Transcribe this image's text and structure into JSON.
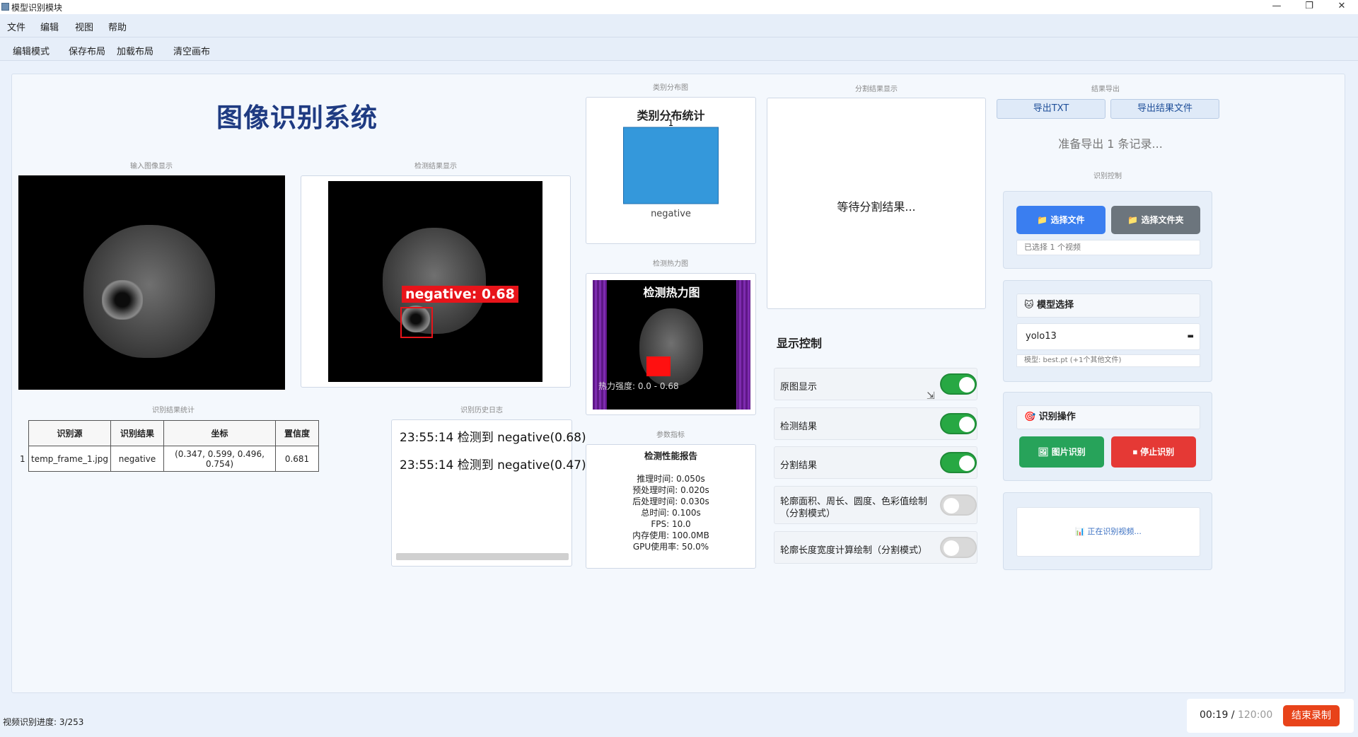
{
  "window": {
    "title": "模型识别模块",
    "controls": {
      "minimize": "—",
      "restore": "❐",
      "close": "✕"
    }
  },
  "menu": [
    "文件",
    "编辑",
    "视图",
    "帮助"
  ],
  "toolbar": [
    "编辑模式",
    "保存布局",
    "加载布局",
    "清空画布"
  ],
  "main_title": "图像识别系统",
  "captions": {
    "input_image": "输入图像显示",
    "result_image": "检测结果显示",
    "category_chart": "类别分布图",
    "segment": "分割结果显示",
    "export": "结果导出",
    "results_table": "识别结果统计",
    "history": "识别历史日志",
    "heatmap": "检测热力图",
    "params": "参数指标",
    "recognition_control": "识别控制"
  },
  "detection": {
    "label": "negative: 0.68"
  },
  "results_table": {
    "headers": [
      "识别源",
      "识别结果",
      "坐标",
      "置信度"
    ],
    "rows": [
      {
        "index": "1",
        "source": "temp_frame_1.jpg",
        "result": "negative",
        "coords": "(0.347, 0.599, 0.496, 0.754)",
        "confidence": "0.681"
      }
    ]
  },
  "history_log": [
    "23:55:14 检测到 negative(0.68)",
    "23:55:14 检测到 negative(0.47)"
  ],
  "chart_data": {
    "type": "bar",
    "title": "类别分布统计",
    "categories": [
      "negative"
    ],
    "values": [
      1
    ],
    "ylim": [
      0,
      1
    ],
    "color": "#3498db"
  },
  "heatmap": {
    "title": "检测热力图",
    "range_text": "热力强度: 0.0 - 0.68"
  },
  "perf_report": {
    "title": "检测性能报告",
    "lines": [
      "推理时间: 0.050s",
      "预处理时间: 0.020s",
      "后处理时间: 0.030s",
      "总时间: 0.100s",
      "FPS: 10.0",
      "内存使用: 100.0MB",
      "GPU使用率: 50.0%"
    ]
  },
  "segment_text": "等待分割结果...",
  "display_control": {
    "title": "显示控制",
    "items": [
      {
        "label": "原图显示",
        "on": true
      },
      {
        "label": "检测结果",
        "on": true
      },
      {
        "label": "分割结果",
        "on": true
      },
      {
        "label": "轮廓面积、周长、圆度、色彩值绘制",
        "label2": "（分割模式）",
        "on": false
      },
      {
        "label": "轮廓长度宽度计算绘制（分割模式）",
        "on": false
      }
    ]
  },
  "export": {
    "txt_button": "导出TXT",
    "file_button": "导出结果文件",
    "status": "准备导出 1 条记录..."
  },
  "file_select": {
    "file_button": "选择文件",
    "folder_button": "选择文件夹",
    "status": "已选择 1 个视频"
  },
  "model": {
    "header": "模型选择",
    "selected": "yolo13",
    "info": "模型: best.pt (+1个其他文件)"
  },
  "ops": {
    "header": "识别操作",
    "image_button": "图片识别",
    "stop_button": "停止识别",
    "status": "正在识别视频..."
  },
  "status_bar": "视频识别进度: 3/253",
  "recording": {
    "elapsed": "00:19",
    "separator": " / ",
    "total": "120:00",
    "button": "结束录制"
  },
  "colors": {
    "title_blue": "#1f3b82",
    "primary_blue": "#3a7ef0",
    "gray_button": "#6c757d",
    "green": "#27a843",
    "red": "#e53935",
    "detection_red": "#e8141a",
    "heat_purple": "#6a1b9a"
  }
}
